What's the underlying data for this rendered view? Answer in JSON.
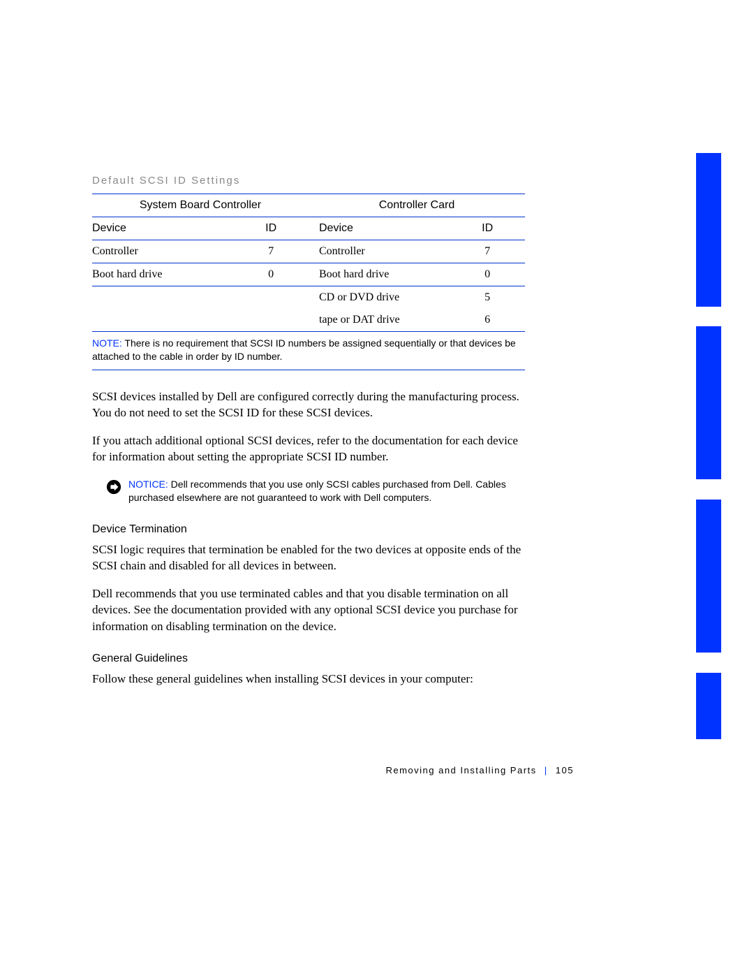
{
  "table": {
    "title": "Default SCSI ID Settings",
    "group_left": "System Board Controller",
    "group_right": "Controller Card",
    "col_device": "Device",
    "col_id": "ID",
    "left_rows": [
      {
        "device": "Controller",
        "id": "7"
      },
      {
        "device": "Boot hard drive",
        "id": "0"
      }
    ],
    "right_rows": [
      {
        "device": "Controller",
        "id": "7"
      },
      {
        "device": "Boot hard drive",
        "id": "0"
      },
      {
        "device": "CD or DVD drive",
        "id": "5"
      },
      {
        "device": "tape or DAT drive",
        "id": "6"
      }
    ],
    "note_label": "NOTE:",
    "note_text": "There is no requirement that SCSI ID numbers be assigned sequentially or that devices be attached to the cable in order by ID number."
  },
  "paragraphs": {
    "p1": "SCSI devices installed by Dell are configured correctly during the manufacturing process. You do not need to set the SCSI ID for these SCSI devices.",
    "p2": "If you attach additional optional SCSI devices, refer to the documentation for each device for information about setting the appropriate SCSI ID number."
  },
  "notice": {
    "label": "NOTICE:",
    "text": "Dell recommends that you use only SCSI cables purchased from Dell. Cables purchased elsewhere are not guaranteed to work with Dell computers."
  },
  "sections": {
    "device_termination": {
      "title": "Device Termination",
      "p1": "SCSI logic requires that termination be enabled for the two devices at opposite ends of the SCSI chain and disabled for all devices in between.",
      "p2": "Dell recommends that you use terminated cables and that you disable termination on all devices. See the documentation provided with any optional SCSI device you purchase for information on disabling termination on the device."
    },
    "general_guidelines": {
      "title": "General Guidelines",
      "p1": "Follow these general guidelines when installing SCSI devices in your computer:"
    }
  },
  "footer": {
    "chapter": "Removing and Installing Parts",
    "page": "105"
  }
}
